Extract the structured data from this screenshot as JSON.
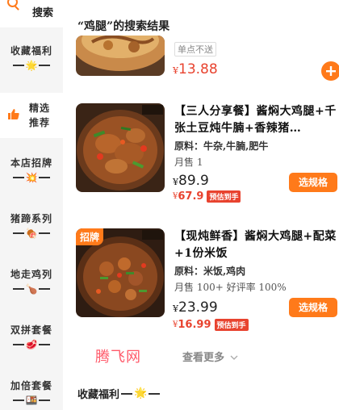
{
  "sidebar": {
    "search_label": "搜索",
    "items": [
      {
        "label": "收藏福利",
        "emoji": "🌟"
      },
      {
        "label1": "精选",
        "label2": "推荐"
      },
      {
        "label": "本店招牌",
        "emoji": "💥"
      },
      {
        "label": "猪蹄系列",
        "emoji": "🍖"
      },
      {
        "label": "地走鸡列",
        "emoji": "🍗"
      },
      {
        "label": "双拼套餐",
        "emoji": "🥩"
      },
      {
        "label": "加倍套餐",
        "emoji": "🍱"
      }
    ]
  },
  "main": {
    "result_title": "“鸡腿”的搜索结果",
    "partial_product": {
      "tag": "单点不送",
      "currency": "¥",
      "price": "13.88",
      "add_icon": "plus-icon"
    },
    "products": [
      {
        "title": "【三人分享餐】酱焖大鸡腿+千张土豆炖牛腩+香辣猪…",
        "ingredients": "原料：牛杂,牛腩,肥牛",
        "sales": "月售 1",
        "currency": "¥",
        "price": "89.9",
        "pre_price": "67.9",
        "pre_tag": "预估到手",
        "button": "选规格"
      },
      {
        "badge": "招牌",
        "title": "【现炖鲜香】酱焖大鸡腿+配菜+1份米饭",
        "ingredients": "原料：米饭,鸡肉",
        "sales": "月售 100+ 好评率 100%",
        "currency": "¥",
        "price": "23.99",
        "pre_price": "16.99",
        "pre_tag": "预估到手",
        "button": "选规格"
      }
    ],
    "watermark": "腾飞网",
    "see_more": "查看更多",
    "section_title": "收藏福利",
    "section_emoji": "🌟"
  },
  "colors": {
    "accent": "#ff7a1a",
    "price_red": "#e8432f",
    "sidebar_bg": "#f5f5f5"
  }
}
